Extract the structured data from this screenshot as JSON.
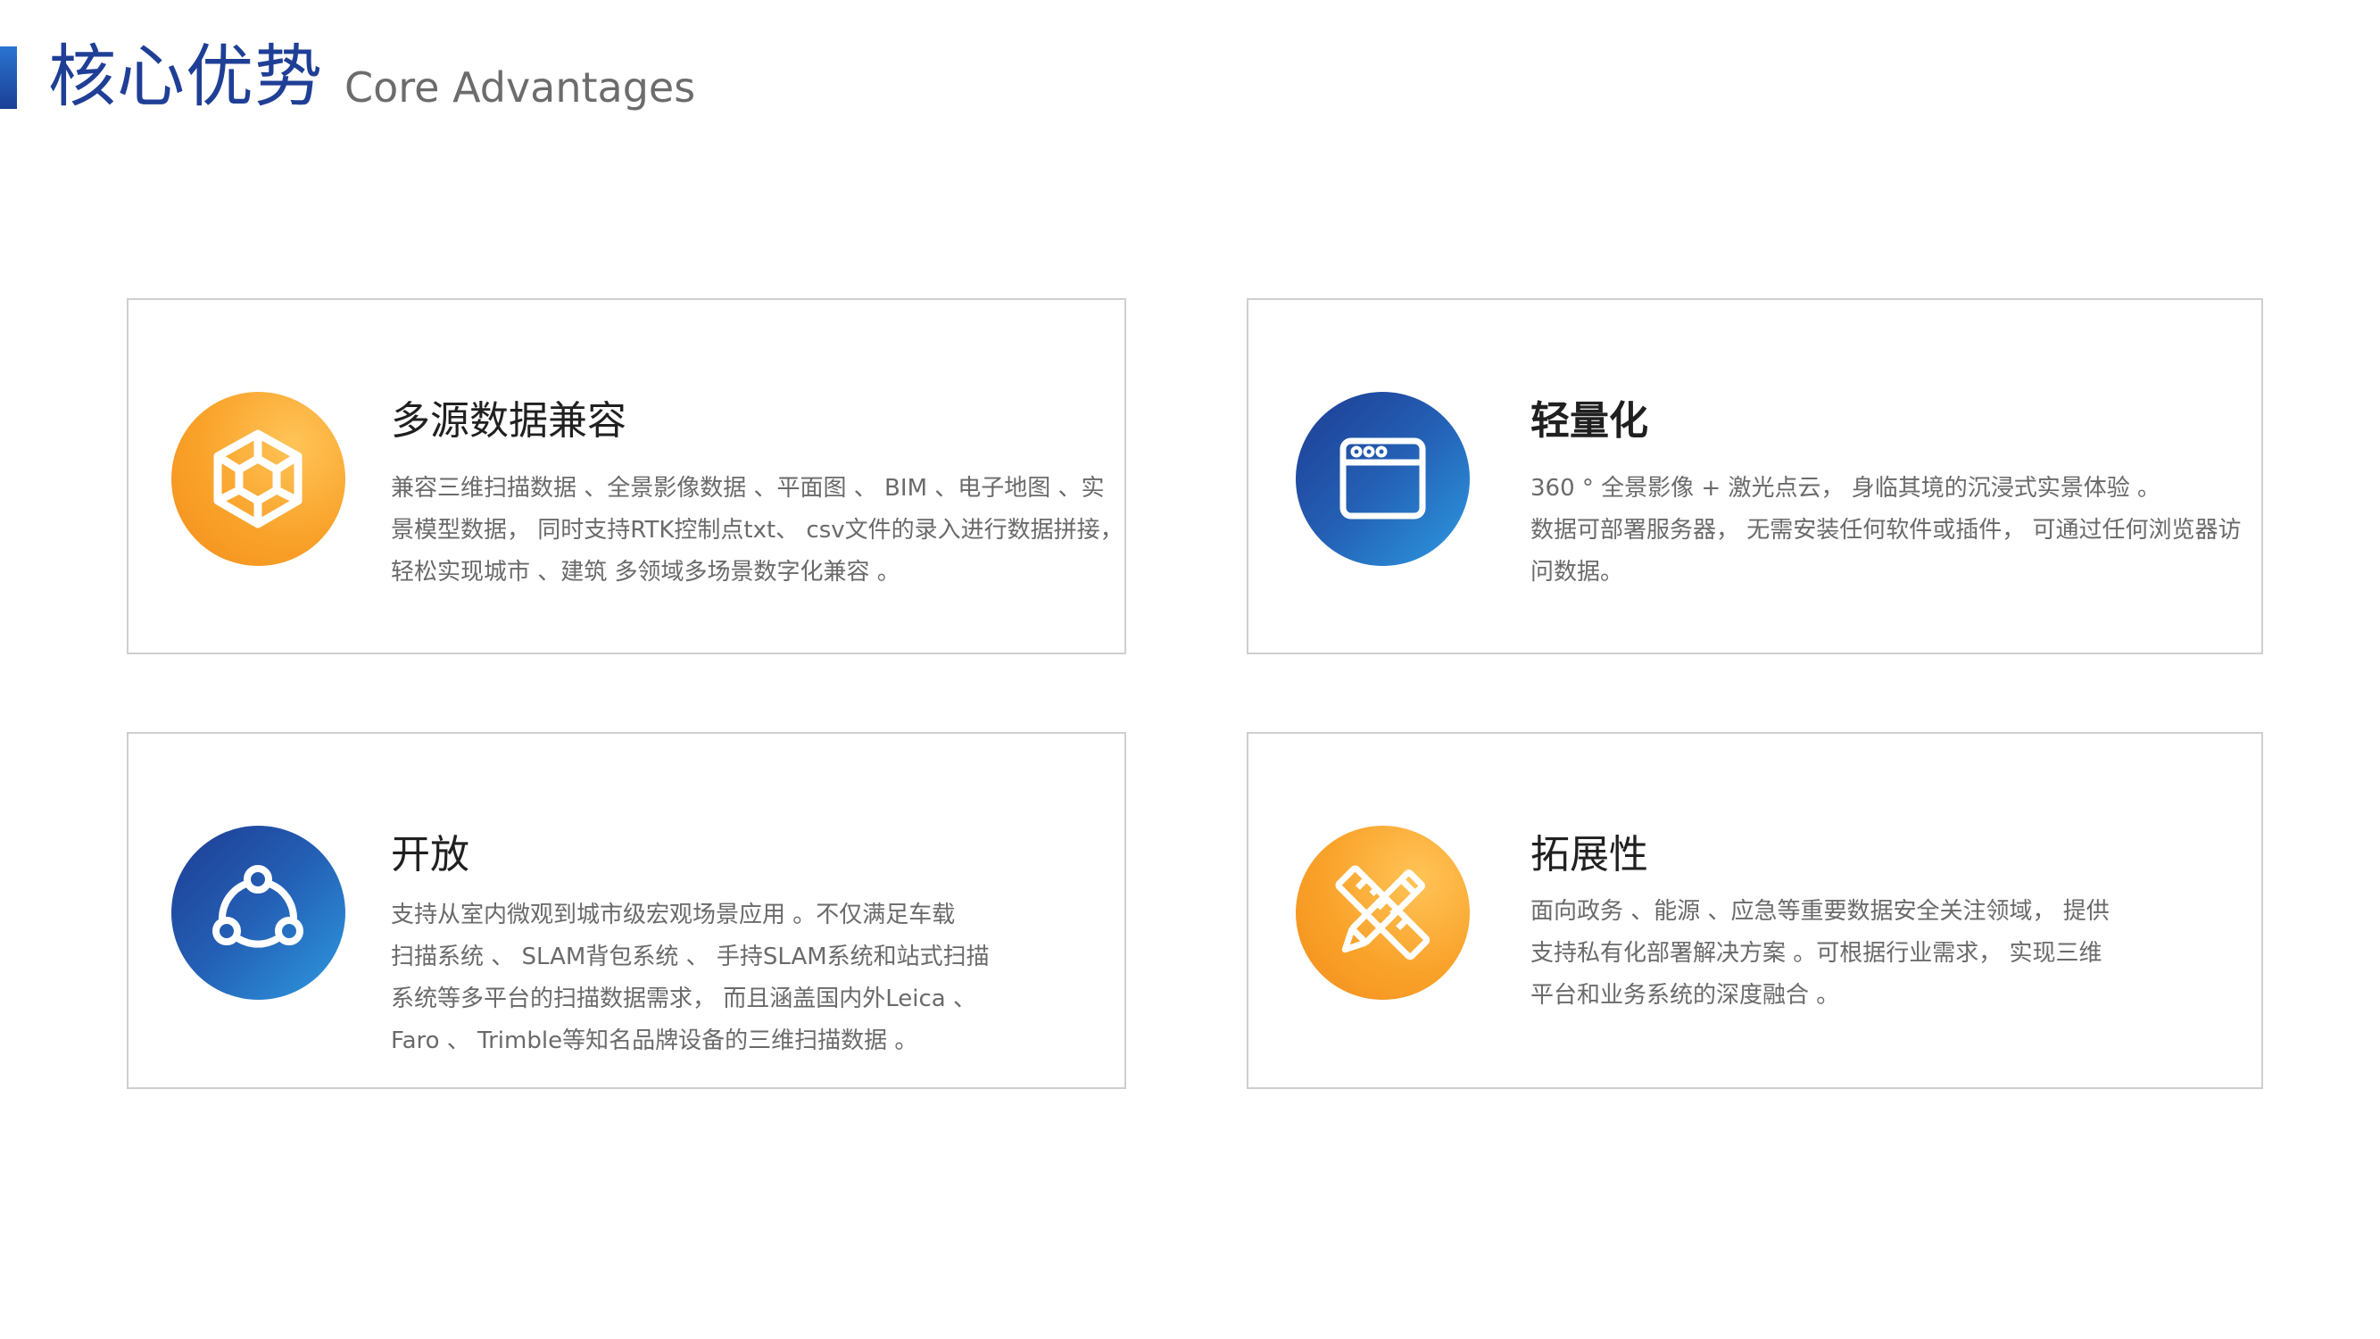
{
  "header": {
    "title": "核心优势",
    "subtitle": "Core Advantages"
  },
  "cards": [
    {
      "title": "多源数据兼容",
      "icon": "cube-icon",
      "icon_color": "#f9a22a",
      "lines": [
        "兼容三维扫描数据 、全景影像数据 、平面图 、 BIM 、电子地图 、实",
        "景模型数据， 同时支持RTK控制点txt、 csv文件的录入进行数据拼接，",
        "轻松实现城市 、建筑 多领域多场景数字化兼容 。"
      ]
    },
    {
      "title": "轻量化",
      "icon": "browser-window-icon",
      "icon_color": "#2460b5",
      "lines": [
        "360 ° 全景影像 + 激光点云， 身临其境的沉浸式实景体验 。",
        "数据可部署服务器， 无需安装任何软件或插件， 可通过任何浏览器访",
        "问数据。"
      ]
    },
    {
      "title": "开放",
      "icon": "share-nodes-icon",
      "icon_color": "#2460b5",
      "lines": [
        "支持从室内微观到城市级宏观场景应用 。不仅满足车载",
        "扫描系统 、 SLAM背包系统 、 手持SLAM系统和站式扫描",
        "系统等多平台的扫描数据需求， 而且涵盖国内外Leica 、",
        "Faro 、 Trimble等知名品牌设备的三维扫描数据 。"
      ]
    },
    {
      "title": "拓展性",
      "icon": "ruler-pencil-icon",
      "icon_color": "#f9a22a",
      "lines": [
        "面向政务 、能源 、应急等重要数据安全关注领域， 提供",
        "支持私有化部署解决方案 。可根据行业需求， 实现三维",
        "平台和业务系统的深度融合 。"
      ]
    }
  ]
}
